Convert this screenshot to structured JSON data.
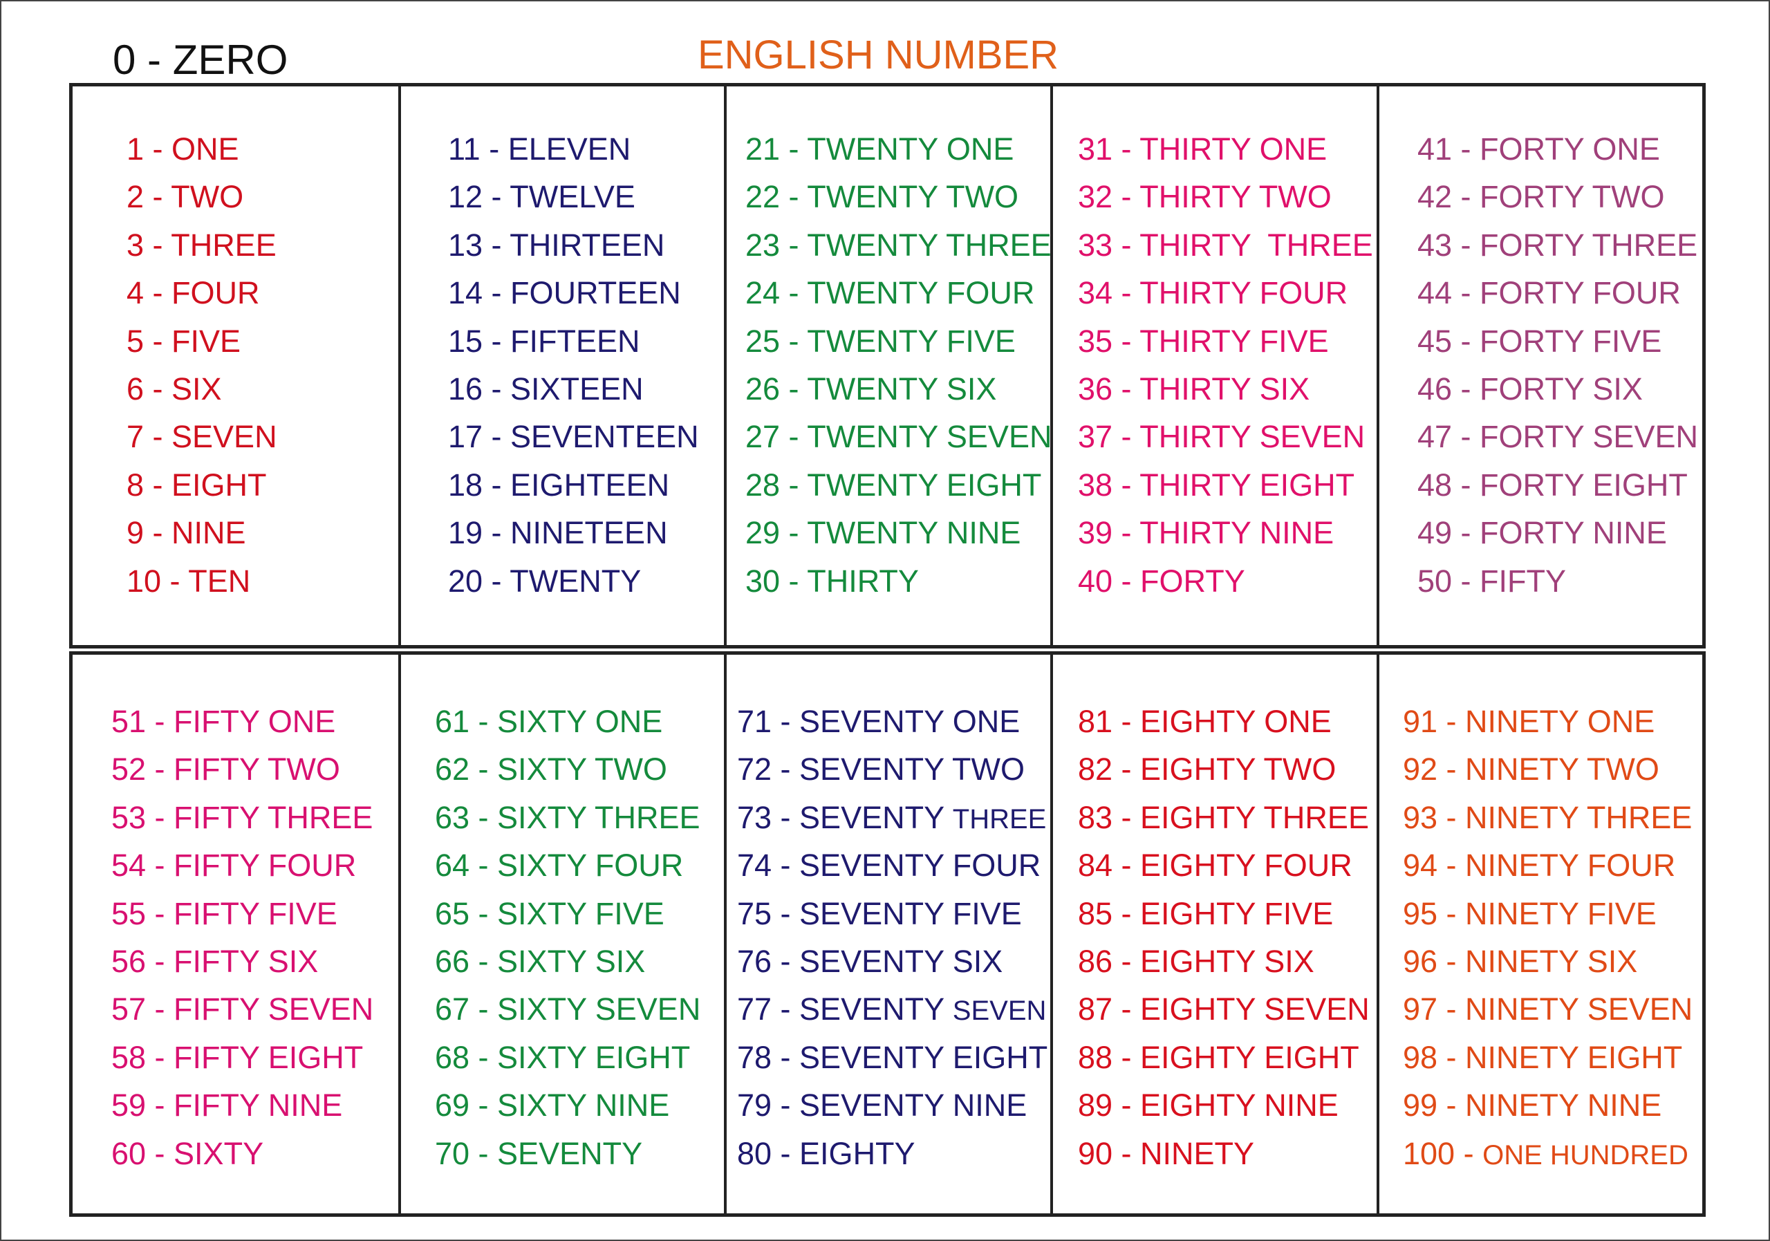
{
  "zero_label": "0 - ZERO",
  "title": "ENGLISH NUMBER",
  "colors": {
    "title": "#e0601a",
    "zero": "#111111"
  },
  "tables": [
    {
      "columns": [
        {
          "color": "#d0101e",
          "items": [
            {
              "main": "1 - ONE"
            },
            {
              "main": "2 - TWO"
            },
            {
              "main": "3 - THREE"
            },
            {
              "main": "4 - FOUR"
            },
            {
              "main": "5 - FIVE"
            },
            {
              "main": "6 - SIX"
            },
            {
              "main": "7 - SEVEN"
            },
            {
              "main": "8 - EIGHT"
            },
            {
              "main": "9 - NINE"
            },
            {
              "main": "10 - TEN"
            }
          ]
        },
        {
          "color": "#1e1a6e",
          "items": [
            {
              "main": "11 - ELEVEN"
            },
            {
              "main": "12 - TWELVE"
            },
            {
              "main": "13 - THIRTEEN"
            },
            {
              "main": "14 - FOURTEEN"
            },
            {
              "main": "15 - FIFTEEN"
            },
            {
              "main": "16 - SIXTEEN"
            },
            {
              "main": "17 - SEVENTEEN"
            },
            {
              "main": "18 - EIGHTEEN"
            },
            {
              "main": "19 - NINETEEN"
            },
            {
              "main": "20 - TWENTY"
            }
          ]
        },
        {
          "color": "#148a3c",
          "items": [
            {
              "main": "21 - TWENTY ONE"
            },
            {
              "main": "22 - TWENTY TWO"
            },
            {
              "main": "23 - TWENTY THREE"
            },
            {
              "main": "24 - TWENTY FOUR"
            },
            {
              "main": "25 - TWENTY FIVE"
            },
            {
              "main": "26 - TWENTY SIX"
            },
            {
              "main": "27 - TWENTY SEVEN"
            },
            {
              "main": "28 - TWENTY EIGHT"
            },
            {
              "main": "29 - TWENTY NINE"
            },
            {
              "main": "30 - THIRTY"
            }
          ]
        },
        {
          "color": "#e0106a",
          "items": [
            {
              "main": "31 - THIRTY ONE"
            },
            {
              "main": "32 - THIRTY TWO"
            },
            {
              "main": "33 - THIRTY  THREE"
            },
            {
              "main": "34 - THIRTY FOUR"
            },
            {
              "main": "35 - THIRTY FIVE"
            },
            {
              "main": "36 - THIRTY SIX"
            },
            {
              "main": "37 - THIRTY SEVEN"
            },
            {
              "main": "38 - THIRTY EIGHT"
            },
            {
              "main": "39 - THIRTY NINE"
            },
            {
              "main": "40 - FORTY"
            }
          ]
        },
        {
          "color": "#a0407a",
          "items": [
            {
              "main": "41 - FORTY ONE"
            },
            {
              "main": "42 - FORTY TWO"
            },
            {
              "main": "43 - FORTY THREE"
            },
            {
              "main": "44 - FORTY FOUR"
            },
            {
              "main": "45 - FORTY FIVE"
            },
            {
              "main": "46 - FORTY SIX"
            },
            {
              "main": "47 - FORTY SEVEN"
            },
            {
              "main": "48 - FORTY EIGHT"
            },
            {
              "main": "49 - FORTY NINE"
            },
            {
              "main": "50 - FIFTY"
            }
          ]
        }
      ]
    },
    {
      "columns": [
        {
          "color": "#d81070",
          "items": [
            {
              "main": "51 - FIFTY ONE"
            },
            {
              "main": "52 - FIFTY TWO"
            },
            {
              "main": "53 - FIFTY THREE"
            },
            {
              "main": "54 - FIFTY FOUR"
            },
            {
              "main": "55 - FIFTY FIVE"
            },
            {
              "main": "56 - FIFTY SIX"
            },
            {
              "main": "57 - FIFTY SEVEN"
            },
            {
              "main": "58 - FIFTY EIGHT"
            },
            {
              "main": "59 - FIFTY NINE"
            },
            {
              "main": "60 - SIXTY"
            }
          ]
        },
        {
          "color": "#148a3c",
          "items": [
            {
              "main": "61 - SIXTY ONE"
            },
            {
              "main": "62 - SIXTY TWO"
            },
            {
              "main": "63 - SIXTY THREE"
            },
            {
              "main": "64 - SIXTY FOUR"
            },
            {
              "main": "65 - SIXTY FIVE"
            },
            {
              "main": "66 - SIXTY SIX"
            },
            {
              "main": "67 - SIXTY SEVEN"
            },
            {
              "main": "68 - SIXTY EIGHT"
            },
            {
              "main": "69 - SIXTY NINE"
            },
            {
              "main": "70 - SEVENTY"
            }
          ]
        },
        {
          "color": "#1e1a6e",
          "items": [
            {
              "main": "71 - SEVENTY ONE"
            },
            {
              "main": "72 - SEVENTY TWO"
            },
            {
              "main": "73 - SEVENTY ",
              "tail": "THREE"
            },
            {
              "main": "74 - SEVENTY FOUR"
            },
            {
              "main": "75 - SEVENTY FIVE"
            },
            {
              "main": "76 - SEVENTY SIX"
            },
            {
              "main": "77 - SEVENTY ",
              "tail": "SEVEN"
            },
            {
              "main": "78 - SEVENTY EIGHT"
            },
            {
              "main": "79 - SEVENTY NINE"
            },
            {
              "main": "80 - EIGHTY"
            }
          ]
        },
        {
          "color": "#d8101e",
          "items": [
            {
              "main": "81 - EIGHTY ONE"
            },
            {
              "main": "82 - EIGHTY TWO"
            },
            {
              "main": "83 - EIGHTY THREE"
            },
            {
              "main": "84 - EIGHTY FOUR"
            },
            {
              "main": "85 - EIGHTY FIVE"
            },
            {
              "main": "86 - EIGHTY SIX"
            },
            {
              "main": "87 - EIGHTY SEVEN"
            },
            {
              "main": "88 - EIGHTY EIGHT"
            },
            {
              "main": "89 - EIGHTY NINE"
            },
            {
              "main": "90 - NINETY"
            }
          ]
        },
        {
          "color": "#e04a16",
          "items": [
            {
              "main": "91 - NINETY ONE"
            },
            {
              "main": "92 - NINETY TWO"
            },
            {
              "main": "93 - NINETY THREE"
            },
            {
              "main": "94 - NINETY FOUR"
            },
            {
              "main": "95 - NINETY FIVE"
            },
            {
              "main": "96 - NINETY SIX"
            },
            {
              "main": "97 - NINETY SEVEN"
            },
            {
              "main": "98 - NINETY EIGHT"
            },
            {
              "main": "99 - NINETY NINE"
            },
            {
              "main": "100 - ",
              "tail": "ONE HUNDRED"
            }
          ]
        }
      ]
    }
  ]
}
